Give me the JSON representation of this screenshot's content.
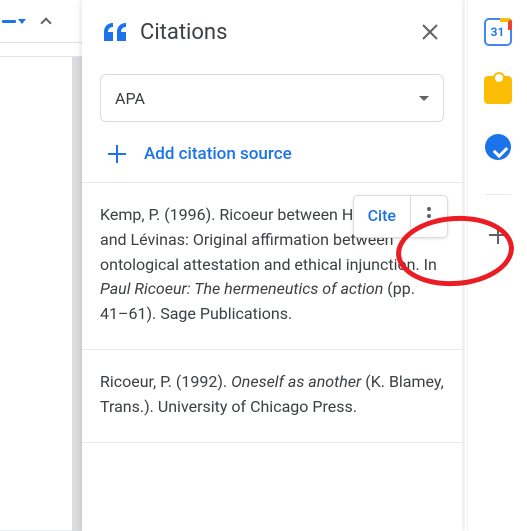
{
  "panel": {
    "title": "Citations",
    "style_selected": "APA",
    "add_source_label": "Add citation source",
    "cite_button_label": "Cite"
  },
  "citations": [
    {
      "pre": "Kemp, P. (1996). Ricoeur between Heidegger and Lévinas: Original affirmation between ontological attestation and ethical injunction. In ",
      "italic": "Paul Ricoeur: The hermeneutics of action",
      "post": " (pp. 41–61). Sage Publications."
    },
    {
      "pre": "Ricoeur, P. (1992). ",
      "italic": "Oneself as another",
      "post": " (K. Blamey, Trans.). University of Chicago Press."
    }
  ],
  "rail": {
    "calendar_day": "31"
  }
}
